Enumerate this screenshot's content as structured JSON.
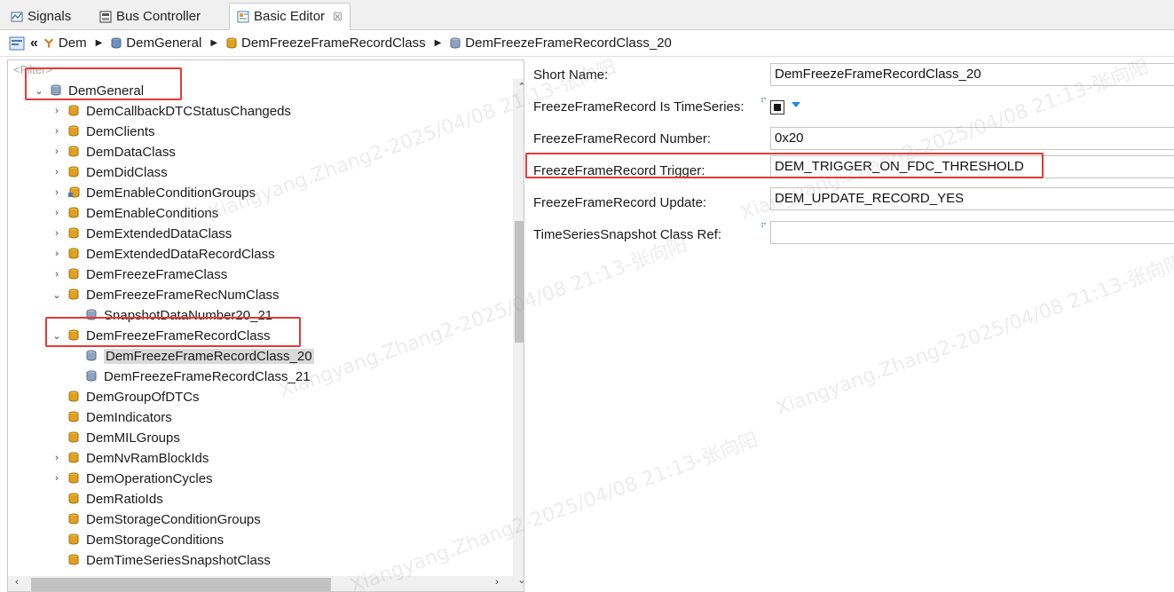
{
  "tabs": [
    {
      "label": "Signals",
      "icon": "signals-icon"
    },
    {
      "label": "Bus Controller",
      "icon": "bus-controller-icon"
    },
    {
      "label": "Basic Editor",
      "icon": "basic-editor-icon",
      "close": "☒"
    }
  ],
  "breadcrumb": {
    "items": [
      "Dem",
      "DemGeneral",
      "DemFreezeFrameRecordClass",
      "DemFreezeFrameRecordClass_20"
    ]
  },
  "tree": {
    "filter_placeholder": "<Filter>",
    "rows": [
      {
        "label": "DemGeneral",
        "expand": "⌄"
      },
      {
        "label": "DemCallbackDTCStatusChangeds",
        "expand": "›"
      },
      {
        "label": "DemClients",
        "expand": "›"
      },
      {
        "label": "DemDataClass",
        "expand": "›"
      },
      {
        "label": "DemDidClass",
        "expand": "›"
      },
      {
        "label": "DemEnableConditionGroups",
        "expand": "›"
      },
      {
        "label": "DemEnableConditions",
        "expand": "›"
      },
      {
        "label": "DemExtendedDataClass",
        "expand": "›"
      },
      {
        "label": "DemExtendedDataRecordClass",
        "expand": "›"
      },
      {
        "label": "DemFreezeFrameClass",
        "expand": "›"
      },
      {
        "label": "DemFreezeFrameRecNumClass",
        "expand": "⌄"
      },
      {
        "label": "SnapshotDataNumber20_21",
        "expand": ""
      },
      {
        "label": "DemFreezeFrameRecordClass",
        "expand": "⌄"
      },
      {
        "label": "DemFreezeFrameRecordClass_20",
        "expand": ""
      },
      {
        "label": "DemFreezeFrameRecordClass_21",
        "expand": ""
      },
      {
        "label": "DemGroupOfDTCs",
        "expand": ""
      },
      {
        "label": "DemIndicators",
        "expand": ""
      },
      {
        "label": "DemMILGroups",
        "expand": ""
      },
      {
        "label": "DemNvRamBlockIds",
        "expand": "›"
      },
      {
        "label": "DemOperationCycles",
        "expand": "›"
      },
      {
        "label": "DemRatioIds",
        "expand": ""
      },
      {
        "label": "DemStorageConditionGroups",
        "expand": ""
      },
      {
        "label": "DemStorageConditions",
        "expand": ""
      },
      {
        "label": "DemTimeSeriesSnapshotClass",
        "expand": ""
      }
    ]
  },
  "form": {
    "short_name_label": "Short Name:",
    "short_name_value": "DemFreezeFrameRecordClass_20",
    "timeseries_label": "FreezeFrameRecord Is TimeSeries:",
    "number_label": "FreezeFrameRecord Number:",
    "number_value": "0x20",
    "trigger_label": "FreezeFrameRecord Trigger:",
    "trigger_value": "DEM_TRIGGER_ON_FDC_THRESHOLD",
    "update_label": "FreezeFrameRecord Update:",
    "update_value": "DEM_UPDATE_RECORD_YES",
    "snapshot_ref_label": "TimeSeriesSnapshot Class Ref:",
    "snapshot_ref_value": ""
  },
  "watermark": "Xiangyang.Zhang2-2025/04/08  21:13-张向阳",
  "colors": {
    "highlight": "#e53935",
    "selection": "#d9d9d9",
    "accent": "#1e88e5"
  }
}
